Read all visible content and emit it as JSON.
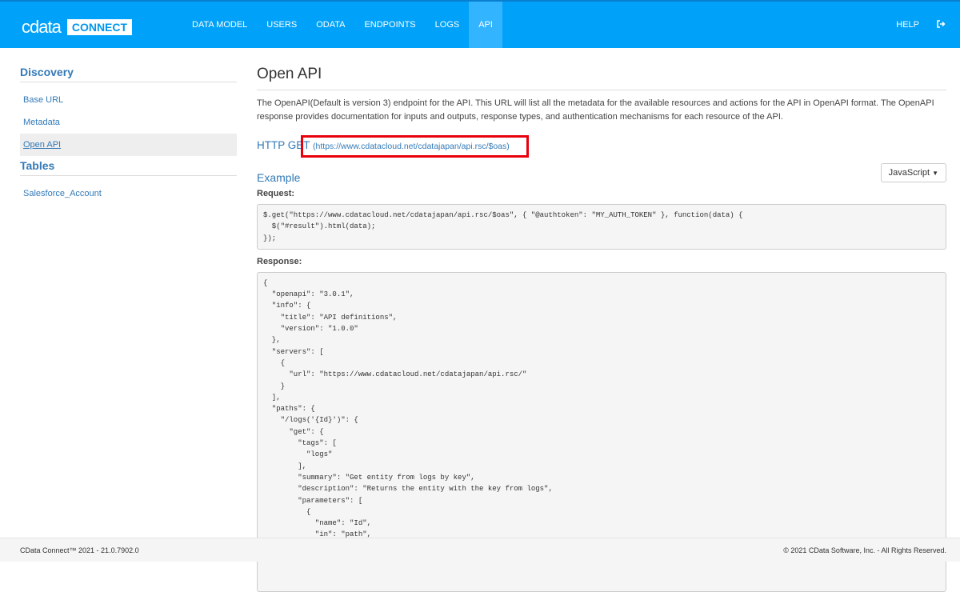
{
  "header": {
    "logo_text": "cdata",
    "logo_badge": "CONNECT",
    "nav": [
      "DATA MODEL",
      "USERS",
      "ODATA",
      "ENDPOINTS",
      "LOGS",
      "API"
    ],
    "help": "HELP",
    "logout_icon": "sign-out-icon"
  },
  "sidebar": {
    "discovery_title": "Discovery",
    "discovery_items": [
      "Base URL",
      "Metadata",
      "Open API"
    ],
    "tables_title": "Tables",
    "tables_items": [
      "Salesforce_Account"
    ]
  },
  "main": {
    "title": "Open API",
    "description": "The OpenAPI(Default is version 3) endpoint for the API. This URL will list all the metadata for the available resources and actions for the API in OpenAPI format. The OpenAPI response provides documentation for inputs and outputs, response types, and authentication mechanisms for each resource of the API.",
    "http_label": "HTTP GET",
    "url": "https://www.cdatacloud.net/cdatajapan/api.rsc/$oas",
    "example_title": "Example",
    "language": "JavaScript",
    "request_label": "Request:",
    "request_code": "$.get(\"https://www.cdatacloud.net/cdatajapan/api.rsc/$oas\", { \"@authtoken\": \"MY_AUTH_TOKEN\" }, function(data) {\n  $(\"#result\").html(data);\n});",
    "response_label": "Response:",
    "response_code": "{\n  \"openapi\": \"3.0.1\",\n  \"info\": {\n    \"title\": \"API definitions\",\n    \"version\": \"1.0.0\"\n  },\n  \"servers\": [\n    {\n      \"url\": \"https://www.cdatacloud.net/cdatajapan/api.rsc/\"\n    }\n  ],\n  \"paths\": {\n    \"/logs('{Id}')\": {\n      \"get\": {\n        \"tags\": [\n          \"logs\"\n        ],\n        \"summary\": \"Get entity from logs by key\",\n        \"description\": \"Returns the entity with the key from logs\",\n        \"parameters\": [\n          {\n            \"name\": \"Id\",\n            \"in\": \"path\",\n            \"description\": \"The key Id\",\n            \"required\": true,"
  },
  "footer": {
    "version": "CData Connect™ 2021 - 21.0.7902.0",
    "copyright": "© 2021 CData Software, Inc. - All Rights Reserved."
  }
}
